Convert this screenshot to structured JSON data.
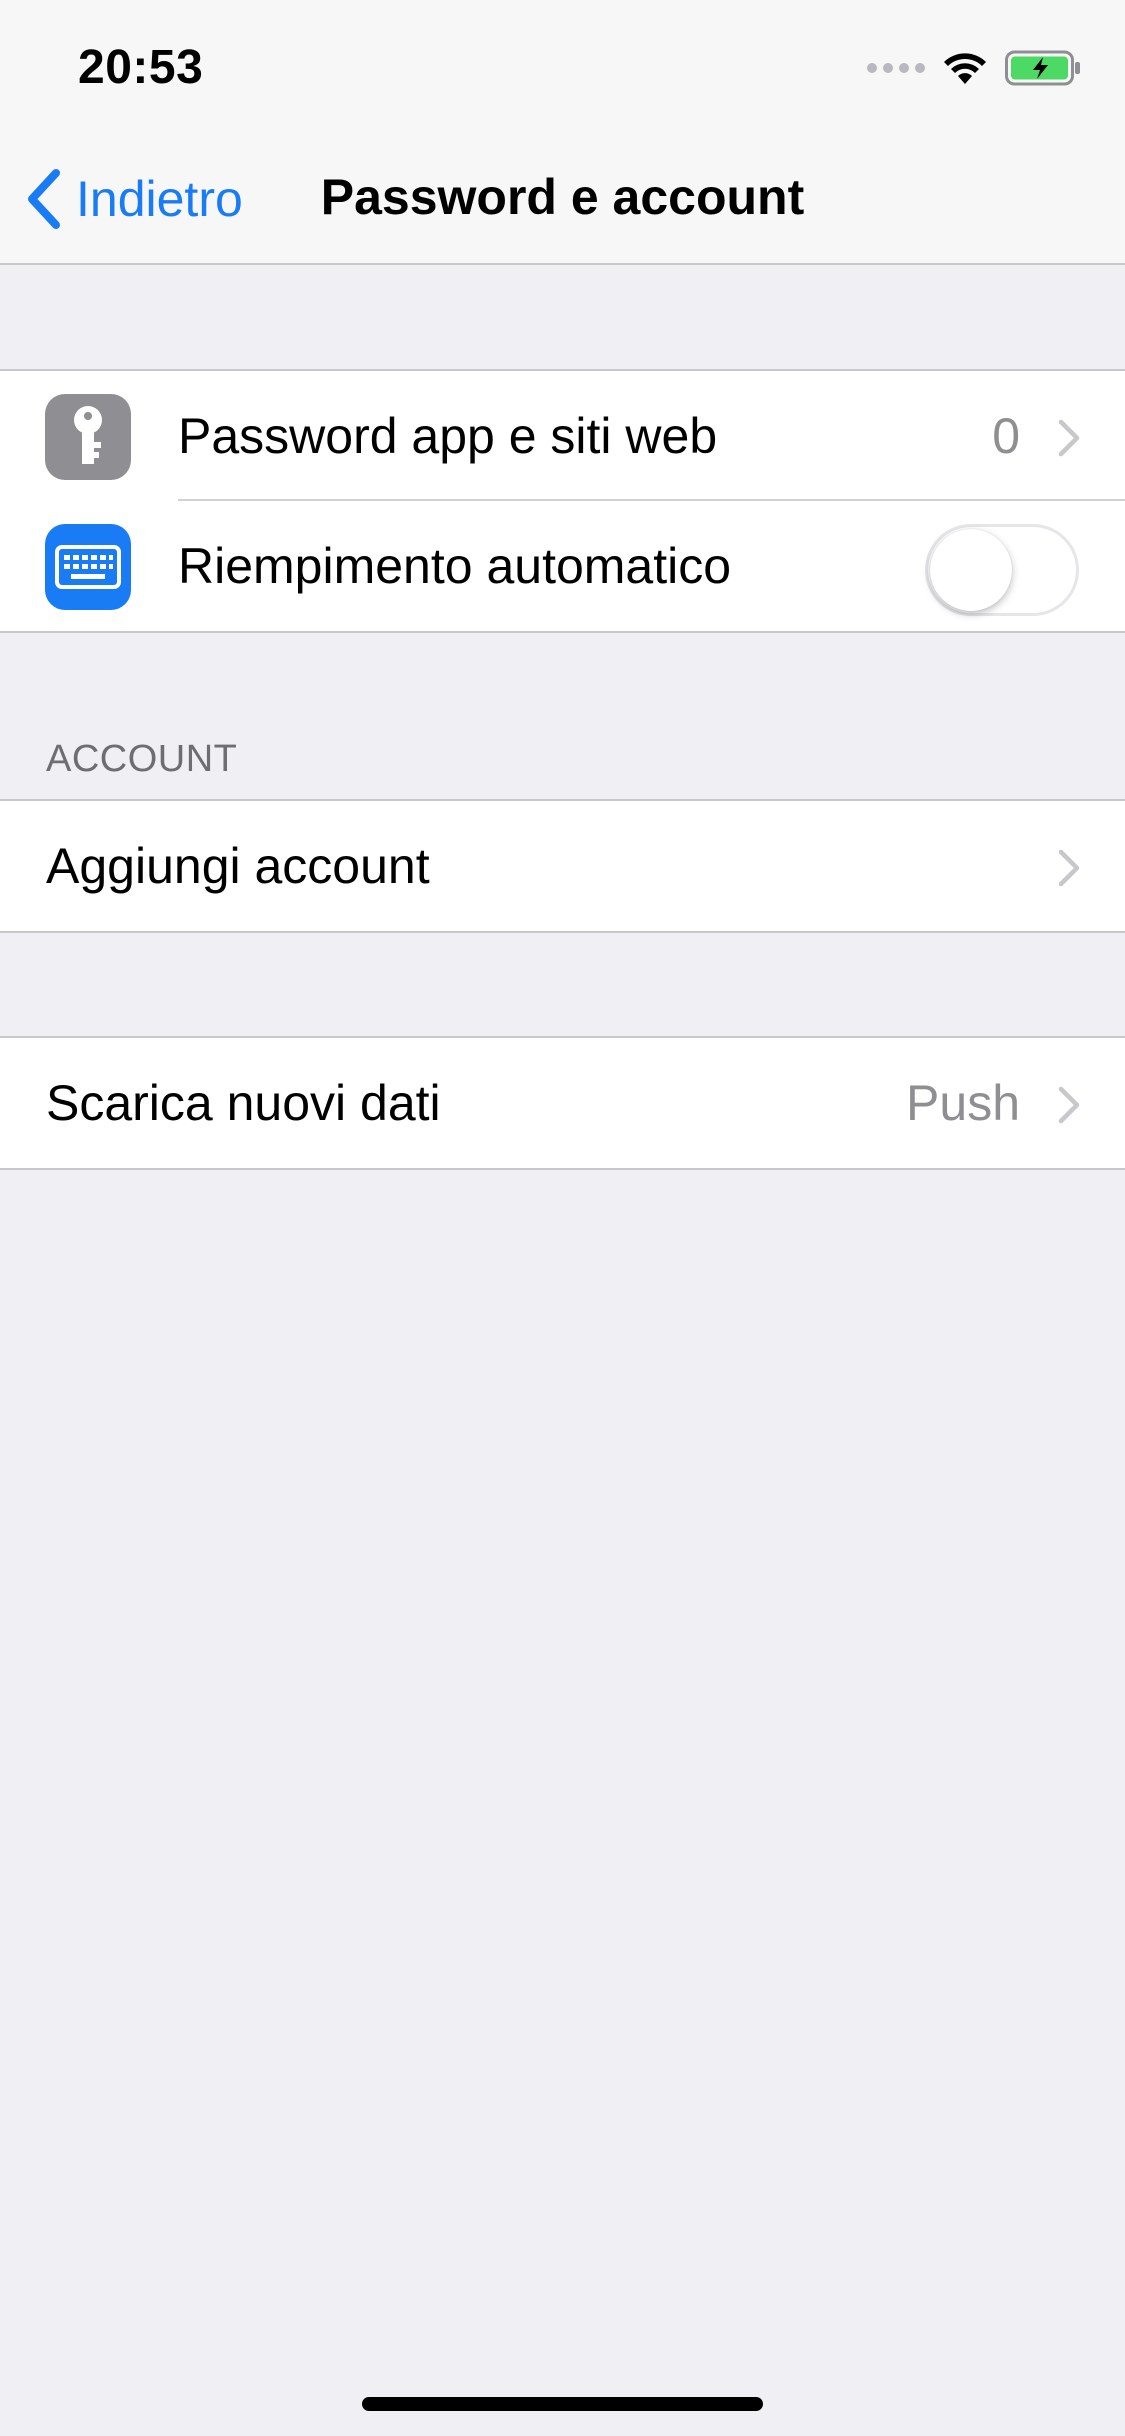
{
  "status_bar": {
    "time": "20:53",
    "icons": [
      "signal-dots-icon",
      "wifi-icon",
      "battery-charging-icon"
    ],
    "battery_color": "#4cd964"
  },
  "nav": {
    "back_label": "Indietro",
    "title": "Password e account",
    "accent_color": "#1a7cf5"
  },
  "group1": {
    "rows": [
      {
        "label": "Password app e siti web",
        "value": "0",
        "icon": "key-icon"
      },
      {
        "label": "Riempimento automatico",
        "icon": "keyboard-icon",
        "toggle_on": false
      }
    ]
  },
  "account_section": {
    "header": "ACCOUNT",
    "rows": [
      {
        "label": "Aggiungi account"
      }
    ]
  },
  "fetch_section": {
    "rows": [
      {
        "label": "Scarica nuovi dati",
        "value": "Push"
      }
    ]
  }
}
